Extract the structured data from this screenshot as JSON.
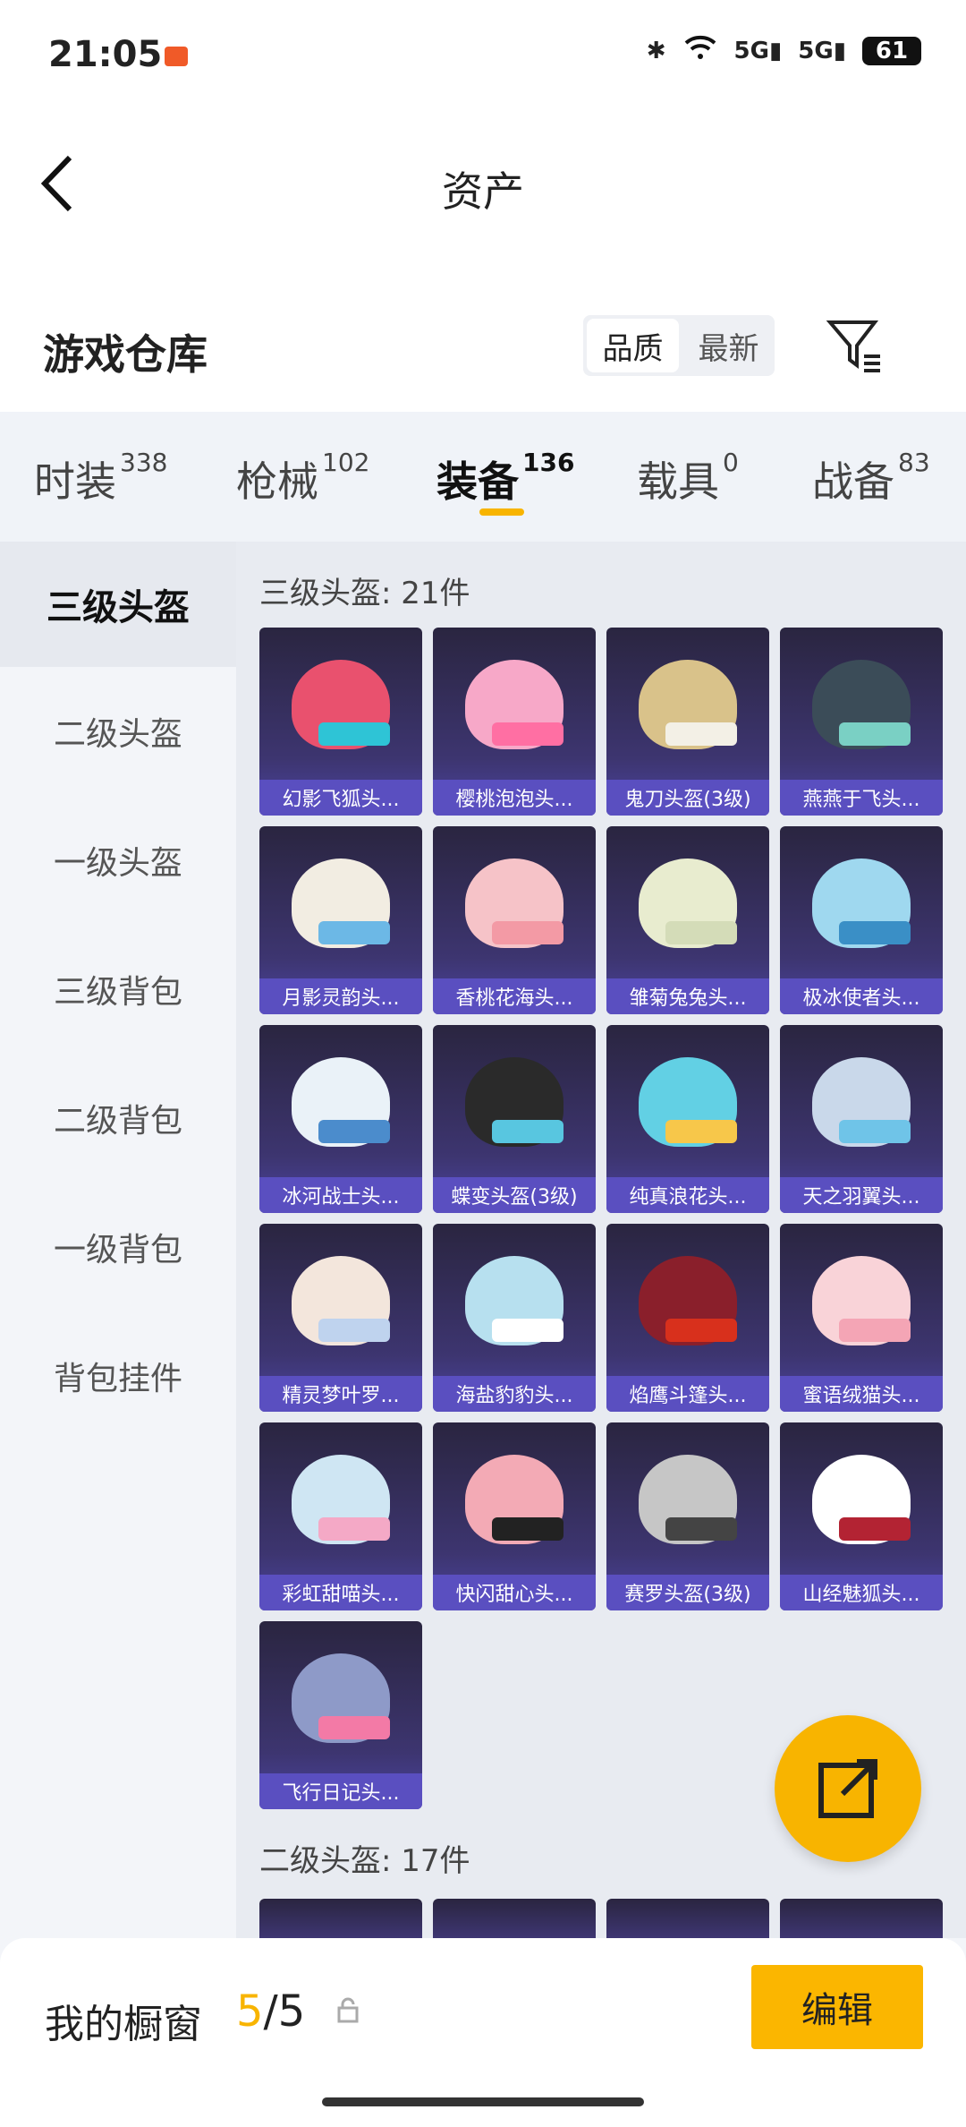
{
  "status": {
    "time": "21:05",
    "battery": "61",
    "net": [
      "5G",
      "5G"
    ]
  },
  "header": {
    "title": "资产"
  },
  "warehouse": {
    "title": "游戏仓库",
    "sort": [
      "品质",
      "最新"
    ]
  },
  "tabs": [
    {
      "label": "时装",
      "count": "338"
    },
    {
      "label": "枪械",
      "count": "102"
    },
    {
      "label": "装备",
      "count": "136"
    },
    {
      "label": "载具",
      "count": "0"
    },
    {
      "label": "战备",
      "count": "83"
    }
  ],
  "side": [
    "三级头盔",
    "二级头盔",
    "一级头盔",
    "三级背包",
    "二级背包",
    "一级背包",
    "背包挂件"
  ],
  "sections": [
    {
      "title": "三级头盔: 21件",
      "items": [
        "幻影飞狐头...",
        "樱桃泡泡头...",
        "鬼刀头盔(3级)",
        "燕燕于飞头...",
        "月影灵韵头...",
        "香桃花海头...",
        "雏菊兔兔头...",
        "极冰使者头...",
        "冰河战士头...",
        "蝶变头盔(3级)",
        "纯真浪花头...",
        "天之羽翼头...",
        "精灵梦叶罗...",
        "海盐豹豹头...",
        "焰鹰斗篷头...",
        "蜜语绒猫头...",
        "彩虹甜喵头...",
        "快闪甜心头...",
        "赛罗头盔(3级)",
        "山经魅狐头...",
        "飞行日记头..."
      ]
    },
    {
      "title": "二级头盔: 17件"
    }
  ],
  "bottom": {
    "label": "我的橱窗",
    "current": "5",
    "total": "/5",
    "edit": "编辑"
  }
}
